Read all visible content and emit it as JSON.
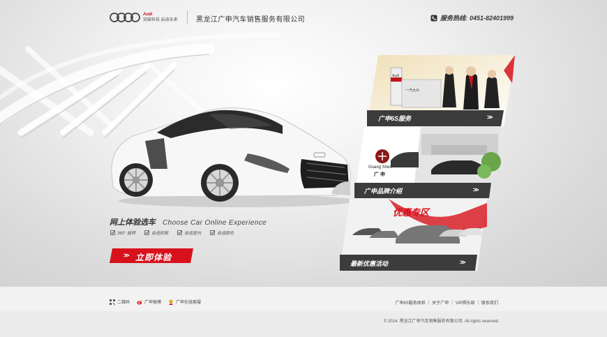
{
  "header": {
    "brand_name": "Audi",
    "brand_slogan": "突破科技 启迪未来",
    "company_name": "黑龙江广申汽车销售服务有限公司",
    "hotline_label": "服务热线:",
    "hotline_number": "0451-82401999"
  },
  "hero": {
    "tagline_cn": "网上体验选车",
    "tagline_en": "Choose Car Online Experience",
    "features": [
      "360° 旋转",
      "自选轮毂",
      "自选室内",
      "自选颜色"
    ],
    "cta_label": "立即体验",
    "car_plate": "Audi"
  },
  "panels": [
    {
      "caption": "广申6S服务",
      "sign_text": "Audi",
      "sign_text2": "一汽大众"
    },
    {
      "caption": "广申品牌介绍",
      "logo_text": "Guang Shen",
      "logo_cn": "广 申"
    },
    {
      "caption": "最新优惠活动",
      "banner_text": "优惠专区"
    }
  ],
  "footer": {
    "left_links": [
      "二维码",
      "广申微博",
      "广申在线客服"
    ],
    "right_links": [
      "广申6S服务体验",
      "关于广申",
      "VIP俱乐部",
      "联系我们"
    ],
    "copyright": "© 2014. 黑龙江广申汽车销售服务有限公司. All rights reserved"
  },
  "colors": {
    "accent_red": "#d7121c",
    "caption_bar": "#3c3c3c"
  }
}
